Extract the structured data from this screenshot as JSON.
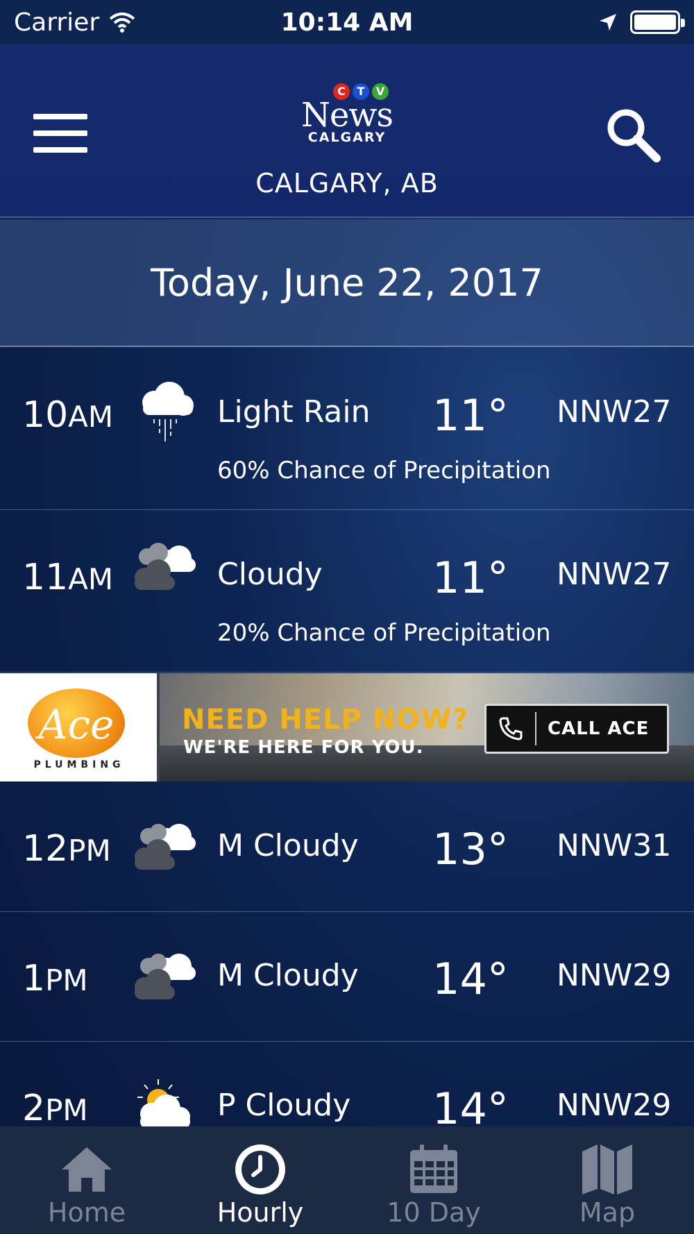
{
  "status_bar": {
    "carrier": "Carrier",
    "time": "10:14 AM"
  },
  "header": {
    "logo": {
      "ctv_letters": [
        "C",
        "T",
        "V"
      ],
      "news": "News",
      "city": "CALGARY"
    },
    "location": "CALGARY, AB"
  },
  "date_banner": "Today, June 22, 2017",
  "forecast": [
    {
      "hour": "10",
      "period": "AM",
      "icon": "light-rain-icon",
      "condition": "Light Rain",
      "temp": "11°",
      "wind": "NNW27",
      "precip": "60% Chance of Precipitation"
    },
    {
      "hour": "11",
      "period": "AM",
      "icon": "cloudy-icon",
      "condition": "Cloudy",
      "temp": "11°",
      "wind": "NNW27",
      "precip": "20% Chance of Precipitation"
    },
    {
      "hour": "12",
      "period": "PM",
      "icon": "mostly-cloudy-icon",
      "condition": "M Cloudy",
      "temp": "13°",
      "wind": "NNW31"
    },
    {
      "hour": "1",
      "period": "PM",
      "icon": "mostly-cloudy-icon",
      "condition": "M Cloudy",
      "temp": "14°",
      "wind": "NNW29"
    },
    {
      "hour": "2",
      "period": "PM",
      "icon": "partly-cloudy-icon",
      "condition": "P Cloudy",
      "temp": "14°",
      "wind": "NNW29"
    }
  ],
  "ad": {
    "brand": "Ace",
    "brand_sub": "PLUMBING",
    "headline": "NEED HELP NOW?",
    "subline": "WE'RE HERE FOR YOU.",
    "cta": "CALL ACE"
  },
  "tabs": [
    {
      "label": "Home",
      "icon": "home-icon"
    },
    {
      "label": "Hourly",
      "icon": "clock-icon",
      "active": true
    },
    {
      "label": "10 Day",
      "icon": "calendar-icon"
    },
    {
      "label": "Map",
      "icon": "map-icon"
    }
  ],
  "colors": {
    "header": "#152b70",
    "tabbar": "#1d2a43",
    "tab_inactive": "#7b8595",
    "ad_headline": "#f2b21a",
    "ctv_red": "#e0251b",
    "ctv_blue": "#1b4fd6",
    "ctv_green": "#3aa835"
  }
}
